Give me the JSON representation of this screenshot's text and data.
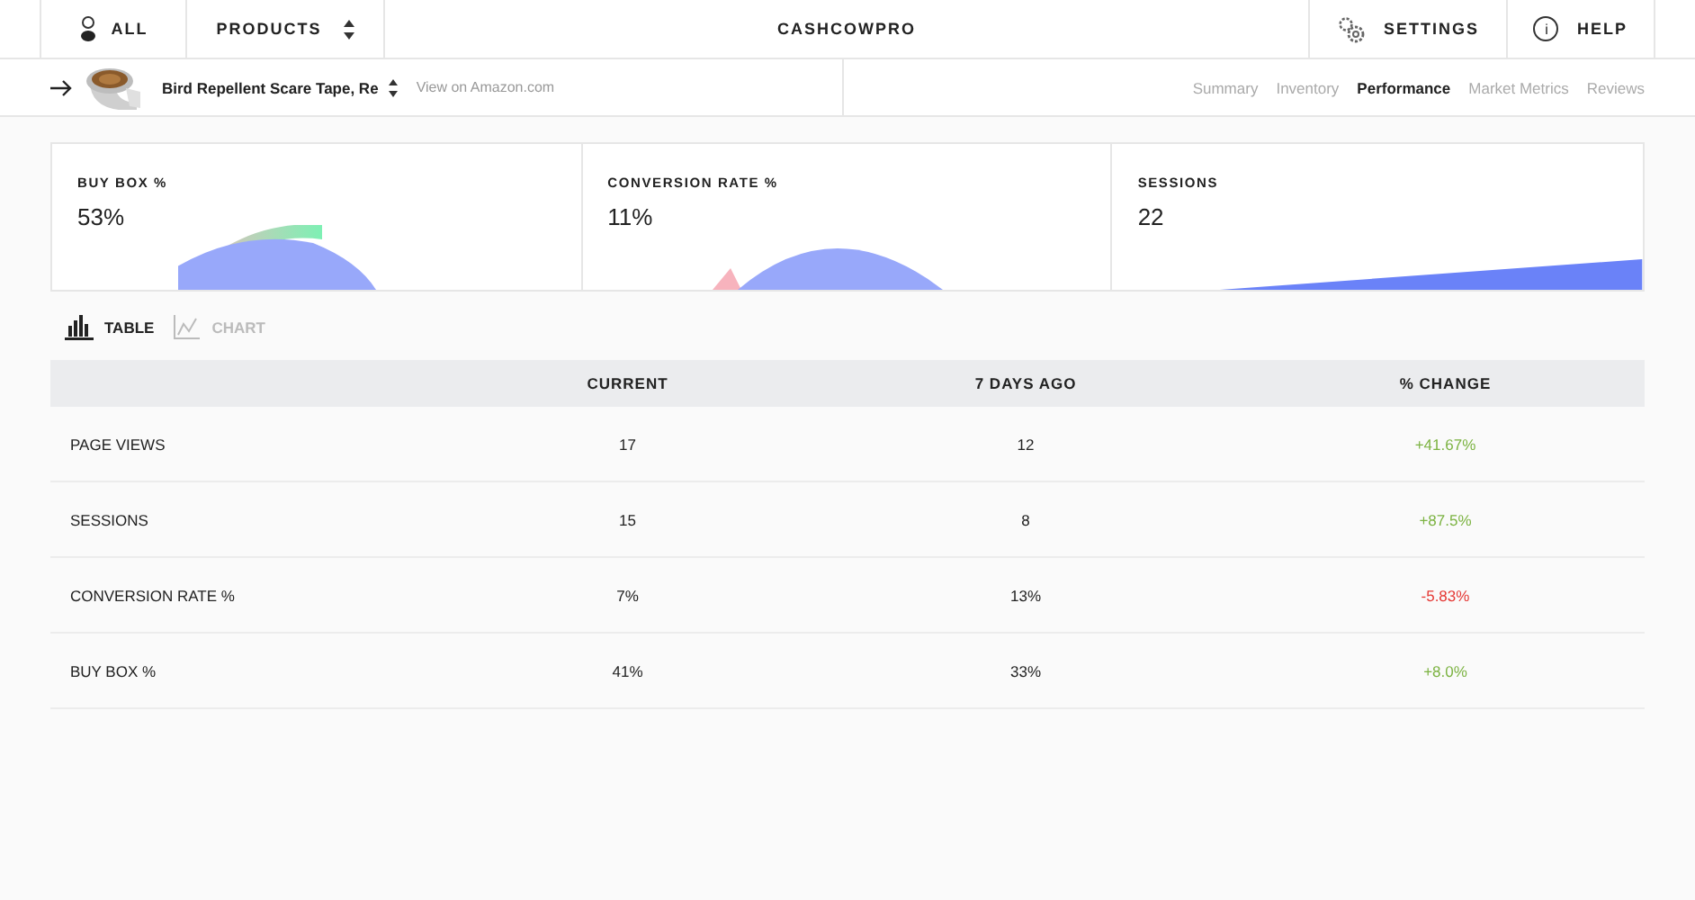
{
  "nav": {
    "all": "ALL",
    "products": "PRODUCTS",
    "title": "CASHCOWPRO",
    "settings": "SETTINGS",
    "help": "HELP",
    "help_glyph": "i"
  },
  "product": {
    "name": "Bird Repellent Scare Tape, Re",
    "link": "View on Amazon.com"
  },
  "tabs": [
    {
      "label": "Summary",
      "selected": false
    },
    {
      "label": "Inventory",
      "selected": false
    },
    {
      "label": "Performance",
      "selected": true
    },
    {
      "label": "Market Metrics",
      "selected": false
    },
    {
      "label": "Reviews",
      "selected": false
    }
  ],
  "cards": [
    {
      "title": "BUY BOX %",
      "value": "53%",
      "kind": "gauge"
    },
    {
      "title": "CONVERSION RATE %",
      "value": "11%",
      "kind": "gauge-low"
    },
    {
      "title": "SESSIONS",
      "value": "22",
      "kind": "area"
    }
  ],
  "view_toggle": [
    {
      "label": "TABLE",
      "kind": "table",
      "selected": true
    },
    {
      "label": "CHART",
      "kind": "chart",
      "selected": false
    }
  ],
  "table": {
    "columns": [
      "CURRENT",
      "7 DAYS AGO",
      "% CHANGE"
    ],
    "rows": [
      {
        "metric": "PAGE VIEWS",
        "current": "17",
        "previous": "12",
        "change": "+41.67%",
        "color": "#7cb342"
      },
      {
        "metric": "SESSIONS",
        "current": "15",
        "previous": "8",
        "change": "+87.5%",
        "color": "#7cb342"
      },
      {
        "metric": "CONVERSION RATE %",
        "current": "7%",
        "previous": "13%",
        "change": "-5.83%",
        "color": "#e53935"
      },
      {
        "metric": "BUY BOX %",
        "current": "41%",
        "previous": "33%",
        "change": "+8.0%",
        "color": "#7cb342"
      }
    ]
  }
}
